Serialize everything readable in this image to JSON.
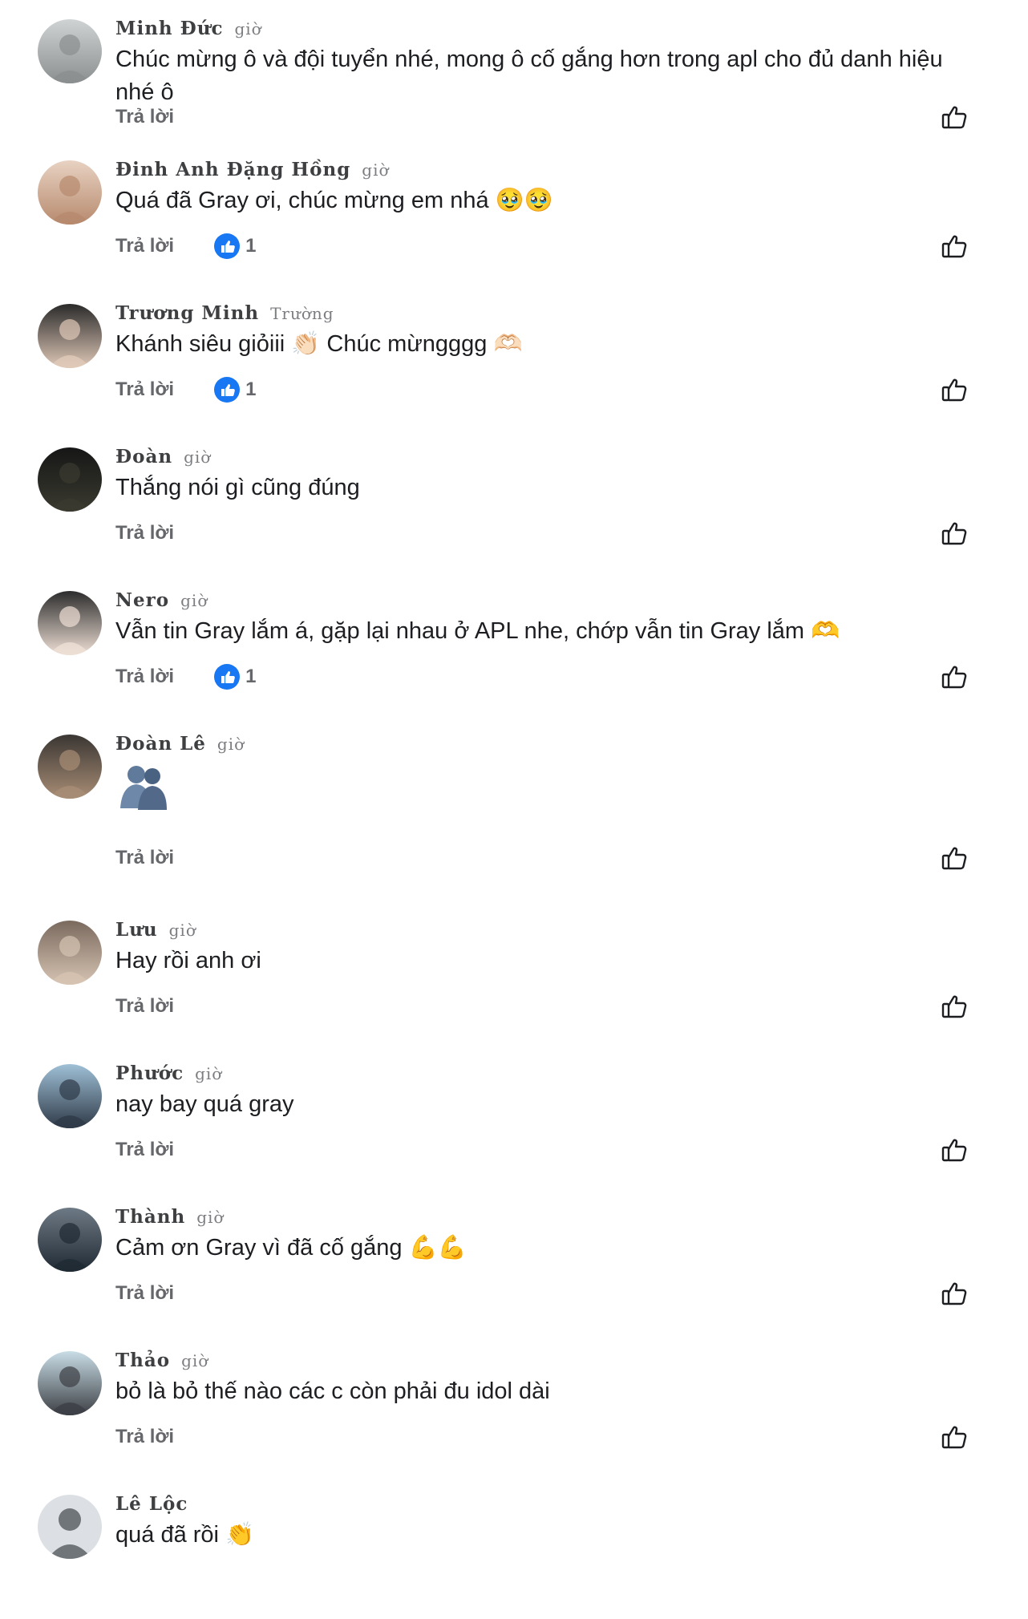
{
  "comments": [
    {
      "author": "Minh Đức",
      "time": "giờ",
      "text": "Chúc mừng ô và đội tuyển nhé, mong ô cố gắng hơn trong apl cho đủ danh hiệu nhé ô",
      "reply_label": "Trả lời",
      "reaction_count": "",
      "avatar_colors": [
        "#cfd3d4",
        "#8b8f8f"
      ]
    },
    {
      "author": "Đinh Anh Đặng Hồng",
      "time": "giờ",
      "text": "Quá đã Gray ơi, chúc mừng em nhá 🥹🥹",
      "reply_label": "Trả lời",
      "reaction_count": "1",
      "avatar_colors": [
        "#e8d2c2",
        "#b78a6e"
      ]
    },
    {
      "author": "Trương Minh",
      "time": "Trường",
      "text": "Khánh siêu giỏiii 👏🏻 Chúc mừngggg 🫶🏻",
      "reply_label": "Trả lời",
      "reaction_count": "1",
      "avatar_colors": [
        "#2a2a2a",
        "#e0c9b8"
      ]
    },
    {
      "author": "Đoàn",
      "time": "giờ",
      "text": "Thắng nói gì cũng đúng",
      "reply_label": "Trả lời",
      "reaction_count": "",
      "avatar_colors": [
        "#161616",
        "#3a3a30"
      ]
    },
    {
      "author": "Nero",
      "time": "giờ",
      "text": "Vẫn tin Gray lắm á, gặp lại nhau ở APL nhe, chớp vẫn tin Gray lắm 🫶",
      "reply_label": "Trả lời",
      "reaction_count": "1",
      "avatar_colors": [
        "#2c2c2c",
        "#efe0d6"
      ]
    },
    {
      "author": "Đoàn Lê",
      "time": "giờ",
      "text": "",
      "sticker": "hug-sticker",
      "reply_label": "Trả lời",
      "reaction_count": "",
      "avatar_colors": [
        "#3a3633",
        "#a88d75"
      ]
    },
    {
      "author": "Lưu",
      "time": "giờ",
      "text": "Hay rồi anh ơi",
      "reply_label": "Trả lời",
      "reaction_count": "",
      "avatar_colors": [
        "#7a6a5e",
        "#d6c3b2"
      ]
    },
    {
      "author": "Phước",
      "time": "giờ",
      "text": "nay bay quá gray",
      "reply_label": "Trả lời",
      "reaction_count": "",
      "avatar_colors": [
        "#9fc0d6",
        "#2f3a48"
      ]
    },
    {
      "author": "Thành",
      "time": "giờ",
      "text": "Cảm ơn Gray vì đã cố gắng 💪💪",
      "reply_label": "Trả lời",
      "reaction_count": "",
      "avatar_colors": [
        "#6e7a85",
        "#1f2a33"
      ]
    },
    {
      "author": "Thảo",
      "time": "giờ",
      "text": "bỏ là bỏ thế nào các c còn phải đu idol dài",
      "reply_label": "Trả lời",
      "reaction_count": "",
      "avatar_colors": [
        "#c9dde6",
        "#3c3f45"
      ]
    },
    {
      "author": "Lê Lộc",
      "time": "",
      "text": "quá đã rồi 👏",
      "reply_label": "",
      "reaction_count": "",
      "avatar_colors": [
        "#dcdfe3",
        "#a8adb3"
      ]
    }
  ],
  "colors": {
    "reaction_blue": "#1877f2",
    "meta_gray": "#65676b",
    "text": "#1c1e21"
  },
  "icons": {
    "like": "thumbs-up-outline-icon",
    "reaction": "like-reaction-icon"
  }
}
